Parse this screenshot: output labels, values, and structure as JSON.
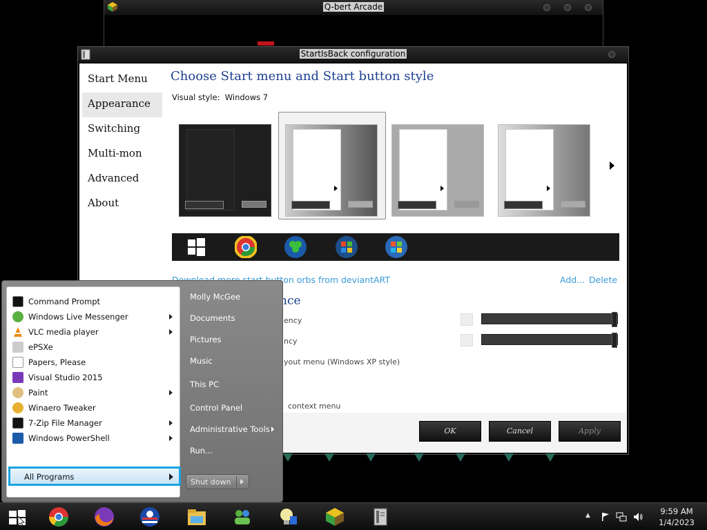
{
  "qbert_window": {
    "title": "Q-bert Arcade"
  },
  "sib_window": {
    "title": "StartIsBack configuration",
    "nav": [
      "Start Menu",
      "Appearance",
      "Switching",
      "Multi-mon",
      "Advanced",
      "About"
    ],
    "active_nav": "Appearance",
    "heading": "Choose Start menu and Start button style",
    "visual_style_label": "Visual style:",
    "visual_style_value": "Windows 7",
    "link_deviantart": "Download more start button orbs from deviantART",
    "link_add": "Add...",
    "link_delete": "Delete",
    "section2_partial": "nce",
    "opt1_partial": "ency",
    "opt2_partial": "ncy",
    "opt3_partial": "yout menu (Windows XP style)",
    "opt4_partial": "context menu",
    "buttons": {
      "ok": "OK",
      "cancel": "Cancel",
      "apply": "Apply"
    }
  },
  "start_menu": {
    "programs": [
      {
        "label": "Command Prompt",
        "icon": "cmd-icon",
        "submenu": false
      },
      {
        "label": "Windows Live Messenger",
        "icon": "messenger-icon",
        "submenu": true
      },
      {
        "label": "VLC media player",
        "icon": "vlc-icon",
        "submenu": true
      },
      {
        "label": "ePSXe",
        "icon": "gamepad-icon",
        "submenu": false
      },
      {
        "label": "Papers, Please",
        "icon": "document-icon",
        "submenu": false
      },
      {
        "label": "Visual Studio 2015",
        "icon": "visual-studio-icon",
        "submenu": false
      },
      {
        "label": "Paint",
        "icon": "paint-icon",
        "submenu": true
      },
      {
        "label": "Winaero Tweaker",
        "icon": "tweaker-icon",
        "submenu": false
      },
      {
        "label": "7-Zip File Manager",
        "icon": "7zip-icon",
        "submenu": true
      },
      {
        "label": "Windows PowerShell",
        "icon": "powershell-icon",
        "submenu": true
      }
    ],
    "all_programs": "All Programs",
    "right": [
      "Molly McGee",
      "Documents",
      "Pictures",
      "Music",
      "This PC",
      "Control Panel",
      "Administrative Tools",
      "Run..."
    ],
    "shutdown": "Shut down"
  },
  "taskbar": {
    "time": "9:59 AM",
    "date": "1/4/2023"
  },
  "colors": {
    "accent": "#1aa3e0",
    "heading": "#1c3f8f",
    "link": "#3a9bd8"
  }
}
